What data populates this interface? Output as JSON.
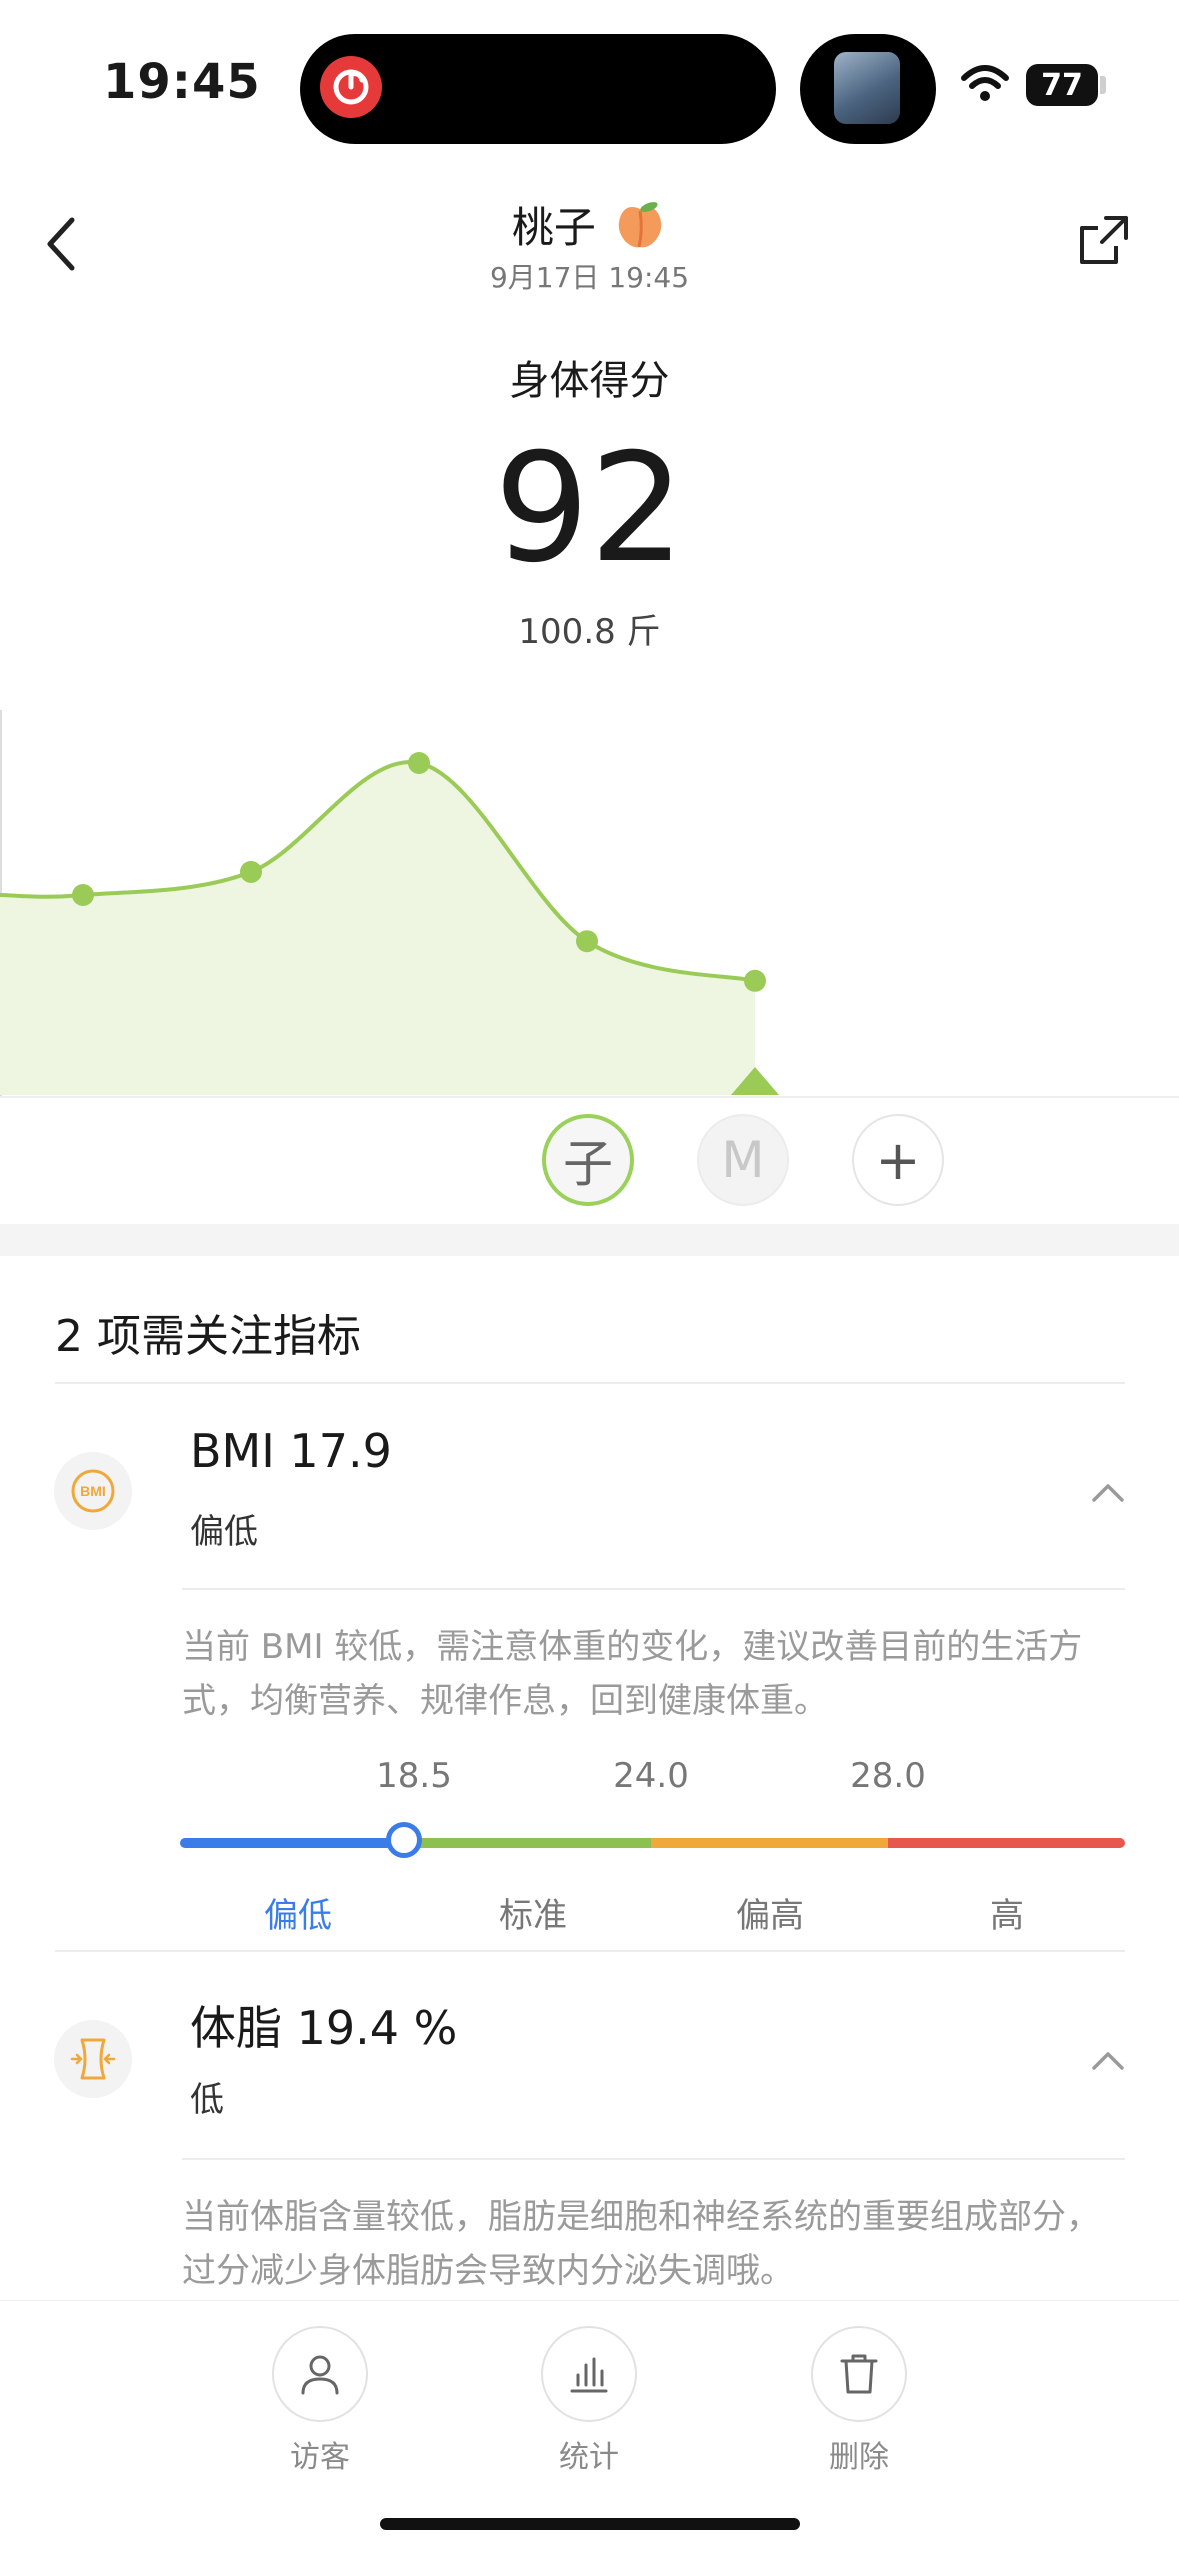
{
  "status_bar": {
    "time": "19:45",
    "battery": "77"
  },
  "header": {
    "name": "桃子",
    "date": "9月17日 19:45"
  },
  "score": {
    "label": "身体得分",
    "value": "92",
    "weight": "100.8 斤"
  },
  "chart_data": {
    "type": "area",
    "y": [
      50,
      57,
      90,
      36,
      24
    ],
    "x": [
      0,
      1,
      2,
      3,
      4
    ],
    "highlighted_index": 4,
    "line_color": "#9bcb57",
    "fill_color": "#eef6e2"
  },
  "profiles": [
    {
      "label": "子",
      "selected": true
    },
    {
      "label": "M",
      "selected": false
    },
    {
      "label": "+",
      "selected": false
    }
  ],
  "attention": {
    "title": "2 项需关注指标",
    "indicators": [
      {
        "icon": "bmi-icon",
        "icon_text": "BMI",
        "title": "BMI 17.9",
        "status": "偏低",
        "description": "当前 BMI 较低，需注意体重的变化，建议改善目前的生活方式，均衡营养、规律作息，回到健康体重。",
        "scale": {
          "ticks": [
            "18.5",
            "24.0",
            "28.0"
          ],
          "labels": [
            "偏低",
            "标准",
            "偏高",
            "高"
          ],
          "colors": [
            "#3a7de8",
            "#8cc152",
            "#f0a83a",
            "#e8574d"
          ],
          "value": 17.9
        }
      },
      {
        "icon": "body-fat-icon",
        "title": "体脂 19.4 %",
        "status": "低",
        "description": "当前体脂含量较低，脂肪是细胞和神经系统的重要组成部分，过分减少身体脂肪会导致内分泌失调哦。"
      }
    ]
  },
  "bottom_bar": {
    "visitor": "访客",
    "stats": "统计",
    "delete": "删除"
  },
  "colors": {
    "accent_green": "#9bcb57",
    "icon_orange": "#f0a83a",
    "low_blue": "#3a7de8"
  }
}
